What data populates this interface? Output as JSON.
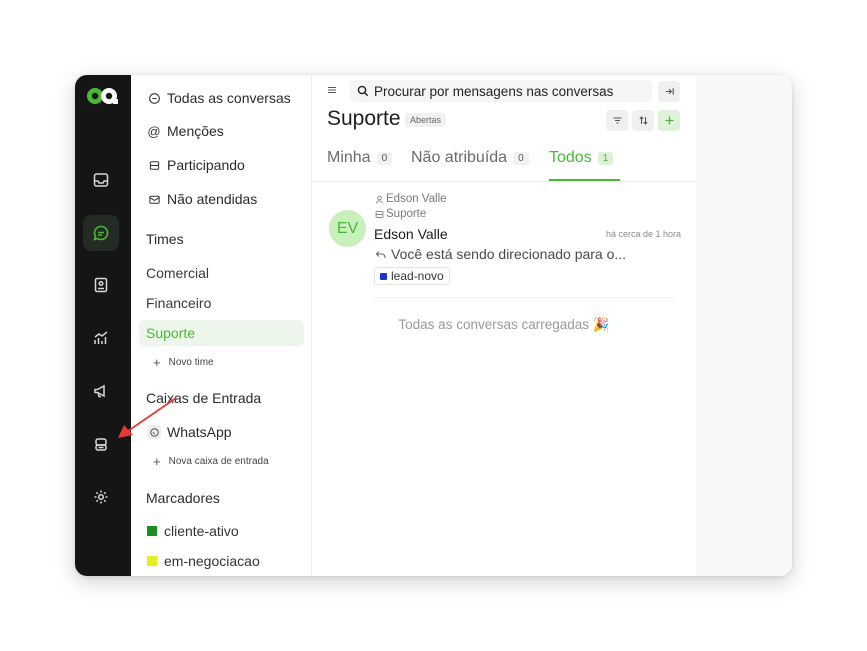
{
  "rail": {
    "items": [
      {
        "icon": "inbox-icon"
      },
      {
        "icon": "chat-icon",
        "active": true
      },
      {
        "icon": "contacts-icon"
      },
      {
        "icon": "reports-icon"
      },
      {
        "icon": "campaigns-icon"
      },
      {
        "icon": "bot-icon"
      },
      {
        "icon": "settings-icon"
      }
    ],
    "accent": "#4ab836"
  },
  "sidebar": {
    "menu": [
      {
        "label": "Todas as conversas",
        "icon": "chat-bubble-icon"
      },
      {
        "label": "Menções",
        "icon": "at-icon"
      },
      {
        "label": "Participando",
        "icon": "participating-icon"
      },
      {
        "label": "Não atendidas",
        "icon": "unattended-icon"
      }
    ],
    "teams_heading": "Times",
    "teams": [
      {
        "label": "Comercial"
      },
      {
        "label": "Financeiro"
      },
      {
        "label": "Suporte",
        "active": true
      }
    ],
    "new_team": "Novo time",
    "inboxes_heading": "Caixas de Entrada",
    "inbox_whatsapp": "WhatsApp",
    "new_inbox": "Nova caixa de entrada",
    "labels_heading": "Marcadores",
    "labels": [
      {
        "label": "cliente-ativo",
        "color": "#1e8e1e"
      },
      {
        "label": "em-negociacao",
        "color": "#e6f01e"
      }
    ]
  },
  "main": {
    "search_placeholder": "Procurar por mensagens nas conversas",
    "title": "Suporte",
    "status": "Abertas",
    "tabs": [
      {
        "label": "Minha",
        "count": "0"
      },
      {
        "label": "Não atribuída",
        "count": "0"
      },
      {
        "label": "Todos",
        "count": "1",
        "active": true
      }
    ],
    "conversation": {
      "avatar_initials": "EV",
      "agent": "Edson Valle",
      "team": "Suporte",
      "name": "Edson Valle",
      "time": "há cerca de 1 hora",
      "message": "Você está sendo direcionado para o...",
      "label": "lead-novo",
      "label_color": "#1a33d6"
    },
    "all_loaded": "Todas as conversas carregadas 🎉"
  }
}
